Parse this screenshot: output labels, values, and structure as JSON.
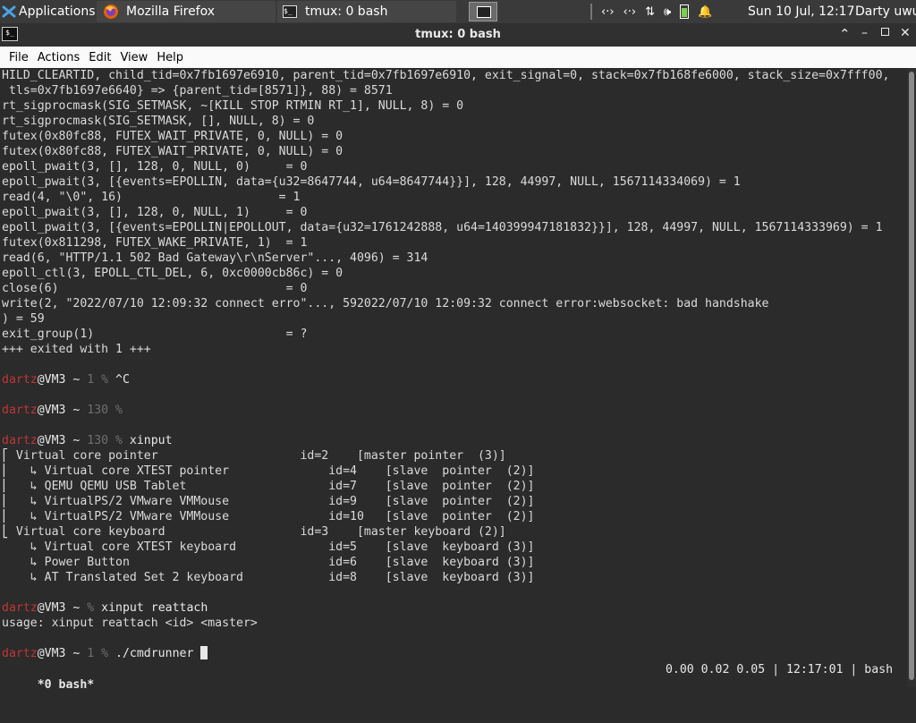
{
  "panel": {
    "applications_label": "Applications",
    "tasks": [
      {
        "label": "Mozilla Firefox"
      },
      {
        "label": "tmux: 0 bash"
      }
    ],
    "clock": "Sun 10 Jul, 12:17",
    "user": "Darty uwu"
  },
  "window": {
    "title": "tmux: 0 bash",
    "menu": [
      "File",
      "Actions",
      "Edit",
      "View",
      "Help"
    ]
  },
  "terminal": {
    "lines": [
      {
        "t": "HILD_CLEARTID, child_tid=0x7fb1697e6910, parent_tid=0x7fb1697e6910, exit_signal=0, stack=0x7fb168fe6000, stack_size=0x7fff00,"
      },
      {
        "t": " tls=0x7fb1697e6640} => {parent_tid=[8571]}, 88) = 8571"
      },
      {
        "t": "rt_sigprocmask(SIG_SETMASK, ~[KILL STOP RTMIN RT_1], NULL, 8) = 0"
      },
      {
        "t": "rt_sigprocmask(SIG_SETMASK, [], NULL, 8) = 0"
      },
      {
        "t": "futex(0x80fc88, FUTEX_WAIT_PRIVATE, 0, NULL) = 0"
      },
      {
        "t": "futex(0x80fc88, FUTEX_WAIT_PRIVATE, 0, NULL) = 0"
      },
      {
        "t": "epoll_pwait(3, [], 128, 0, NULL, 0)     = 0"
      },
      {
        "t": "epoll_pwait(3, [{events=EPOLLIN, data={u32=8647744, u64=8647744}}], 128, 44997, NULL, 1567114334069) = 1"
      },
      {
        "t": "read(4, \"\\0\", 16)                      = 1"
      },
      {
        "t": "epoll_pwait(3, [], 128, 0, NULL, 1)     = 0"
      },
      {
        "t": "epoll_pwait(3, [{events=EPOLLIN|EPOLLOUT, data={u32=1761242888, u64=140399947181832}}], 128, 44997, NULL, 1567114333969) = 1"
      },
      {
        "t": "futex(0x811298, FUTEX_WAKE_PRIVATE, 1)  = 1"
      },
      {
        "t": "read(6, \"HTTP/1.1 502 Bad Gateway\\r\\nServer\"..., 4096) = 314"
      },
      {
        "t": "epoll_ctl(3, EPOLL_CTL_DEL, 6, 0xc0000cb86c) = 0"
      },
      {
        "t": "close(6)                                = 0"
      },
      {
        "t": "write(2, \"2022/07/10 12:09:32 connect erro\"..., 592022/07/10 12:09:32 connect error:websocket: bad handshake"
      },
      {
        "t": ") = 59"
      },
      {
        "t": "exit_group(1)                           = ?"
      },
      {
        "t": "+++ exited with 1 +++"
      },
      {
        "t": ""
      },
      {
        "prompt": {
          "user": "dartz",
          "host": "@VM3 ~ ",
          "code": "1 % ",
          "cmd": "^C"
        }
      },
      {
        "t": ""
      },
      {
        "prompt": {
          "user": "dartz",
          "host": "@VM3 ~ ",
          "code": "130 % ",
          "cmd": ""
        }
      },
      {
        "t": ""
      },
      {
        "prompt": {
          "user": "dartz",
          "host": "@VM3 ~ ",
          "code": "130 % ",
          "cmd": "xinput"
        }
      },
      {
        "t": "⎡ Virtual core pointer                    id=2    [master pointer  (3)]"
      },
      {
        "t": "⎜   ↳ Virtual core XTEST pointer              id=4    [slave  pointer  (2)]"
      },
      {
        "t": "⎜   ↳ QEMU QEMU USB Tablet                    id=7    [slave  pointer  (2)]"
      },
      {
        "t": "⎜   ↳ VirtualPS/2 VMware VMMouse              id=9    [slave  pointer  (2)]"
      },
      {
        "t": "⎜   ↳ VirtualPS/2 VMware VMMouse              id=10   [slave  pointer  (2)]"
      },
      {
        "t": "⎣ Virtual core keyboard                   id=3    [master keyboard (2)]"
      },
      {
        "t": "    ↳ Virtual core XTEST keyboard             id=5    [slave  keyboard (3)]"
      },
      {
        "t": "    ↳ Power Button                            id=6    [slave  keyboard (3)]"
      },
      {
        "t": "    ↳ AT Translated Set 2 keyboard            id=8    [slave  keyboard (3)]"
      },
      {
        "t": ""
      },
      {
        "prompt": {
          "user": "dartz",
          "host": "@VM3 ~ ",
          "code": "% ",
          "cmd": "xinput reattach"
        }
      },
      {
        "t": "usage: xinput reattach <id> <master>"
      },
      {
        "t": ""
      },
      {
        "prompt": {
          "user": "dartz",
          "host": "@VM3 ~ ",
          "code": "1 % ",
          "cmd": "./cmdrunner "
        },
        "cursor": true
      }
    ]
  },
  "tmux_status": {
    "left": " *0 bash*",
    "right": "0.00 0.02 0.05 | 12:17:01 | bash "
  },
  "colors": {
    "panel_bg": "#3a3a3a",
    "terminal_bg": "#2b2b2b",
    "prompt_user": "#c03535",
    "prompt_dim": "#6e6e6e",
    "menubar_bg": "#fafafa"
  }
}
